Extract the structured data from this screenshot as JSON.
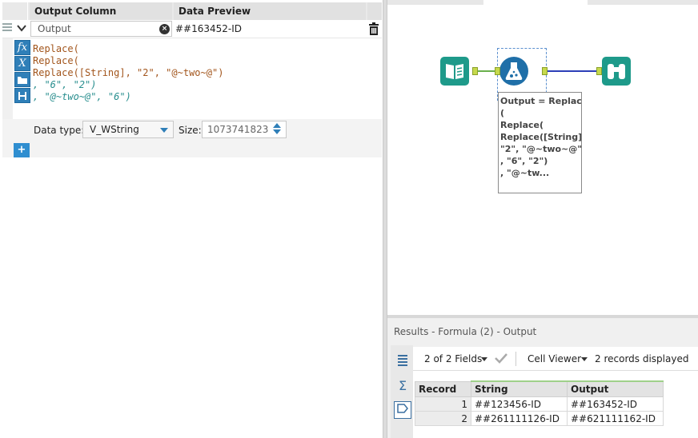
{
  "formula_panel": {
    "headers": {
      "output_column": "Output Column",
      "data_preview": "Data Preview"
    },
    "row": {
      "output_field": "Output",
      "data_preview": "##163452-ID",
      "expression_lines": [
        "Replace(",
        "Replace(",
        "Replace([String], \"2\", \"@~two~@\")",
        ", \"6\", \"2\")",
        ", \"@~two~@\", \"6\")"
      ],
      "data_type_label": "Data type:",
      "data_type": "V_WString",
      "size_label": "Size:",
      "size": "1073741823"
    },
    "editor_tools": [
      "fx",
      "X",
      "folder-icon",
      "save-icon"
    ],
    "add_button": "+"
  },
  "canvas": {
    "annotation": "Output = Replace\n(\nReplace(\nReplace([String],\n\"2\", \"@~two~@\")\n, \"6\", \"2\")\n, \"@~tw..."
  },
  "results": {
    "title": "Results - Formula (2) - Output",
    "fields_selector": "2 of 2 Fields",
    "cell_viewer": "Cell Viewer",
    "records_count": "2 records displayed",
    "columns": [
      "Record",
      "String",
      "Output"
    ],
    "rows": [
      {
        "record": "1",
        "string": "##123456-ID",
        "output": "##163452-ID"
      },
      {
        "record": "2",
        "string": "##261111126-ID",
        "output": "##621111162-ID"
      }
    ]
  },
  "colors": {
    "accent": "#2f7fb8",
    "tool_teal": "#1e9a8a",
    "tool_blue": "#1f6fa8",
    "connector_blue": "#2c3fb8",
    "connector_green": "#6ab04c"
  }
}
